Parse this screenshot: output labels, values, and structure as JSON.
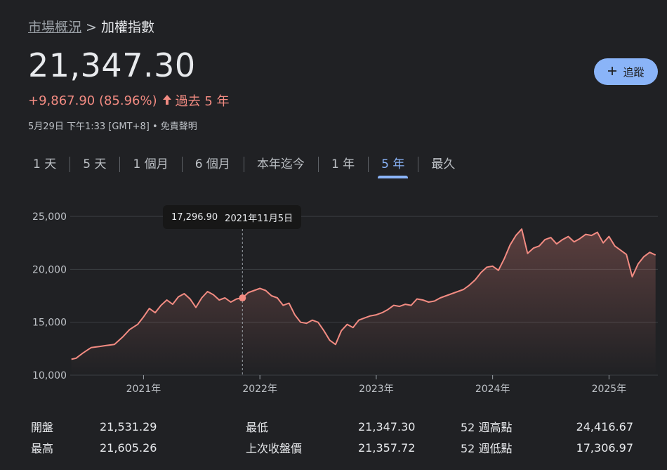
{
  "breadcrumb": {
    "parent": "市場概況",
    "separator": ">",
    "current": "加權指數"
  },
  "price": "21,347.30",
  "change": {
    "text": "+9,867.90 (85.96%)",
    "arrow": "🠅",
    "period": "過去 5 年"
  },
  "meta": "5月29日 下午1:33 [GMT+8] • 免責聲明",
  "follow_button": {
    "icon": "plus-icon",
    "label": "追蹤"
  },
  "tabs": [
    "1 天",
    "5 天",
    "1 個月",
    "6 個月",
    "本年迄今",
    "1 年",
    "5 年",
    "最久"
  ],
  "active_tab": "5 年",
  "colors": {
    "line": "#f28b82",
    "accent": "#8ab4f8",
    "background": "#202124"
  },
  "tooltip": {
    "value": "17,296.90",
    "date": "2021年11月5日"
  },
  "chart_data": {
    "type": "area",
    "ylim": [
      10000,
      25000
    ],
    "y_ticks": [
      "25,000",
      "20,000",
      "15,000",
      "10,000"
    ],
    "x_ticks": [
      "2021年",
      "2022年",
      "2023年",
      "2024年",
      "2025年"
    ],
    "xlim": [
      2020.37,
      2025.42
    ],
    "highlight": {
      "x": 2021.85,
      "y": 17296.9
    },
    "series": [
      {
        "x": [
          2020.38,
          2020.42,
          2020.48,
          2020.55,
          2020.62,
          2020.68,
          2020.75,
          2020.82,
          2020.88,
          2020.95,
          2021.0,
          2021.05,
          2021.1,
          2021.15,
          2021.2,
          2021.25,
          2021.3,
          2021.35,
          2021.4,
          2021.45,
          2021.5,
          2021.55,
          2021.6,
          2021.65,
          2021.7,
          2021.75,
          2021.8,
          2021.85,
          2021.9,
          2021.95,
          2022.0,
          2022.05,
          2022.1,
          2022.15,
          2022.2,
          2022.25,
          2022.3,
          2022.35,
          2022.4,
          2022.45,
          2022.5,
          2022.55,
          2022.6,
          2022.65,
          2022.7,
          2022.75,
          2022.8,
          2022.85,
          2022.9,
          2022.95,
          2023.0,
          2023.05,
          2023.1,
          2023.15,
          2023.2,
          2023.25,
          2023.3,
          2023.35,
          2023.4,
          2023.45,
          2023.5,
          2023.55,
          2023.6,
          2023.65,
          2023.7,
          2023.75,
          2023.8,
          2023.85,
          2023.9,
          2023.95,
          2024.0,
          2024.05,
          2024.1,
          2024.15,
          2024.2,
          2024.25,
          2024.3,
          2024.35,
          2024.4,
          2024.45,
          2024.5,
          2024.55,
          2024.6,
          2024.65,
          2024.7,
          2024.75,
          2024.8,
          2024.85,
          2024.9,
          2024.95,
          2025.0,
          2025.05,
          2025.1,
          2025.15,
          2025.2,
          2025.25,
          2025.3,
          2025.35,
          2025.4
        ],
        "y": [
          11500,
          11600,
          12100,
          12600,
          12700,
          12800,
          12900,
          13600,
          14300,
          14800,
          15500,
          16300,
          15900,
          16600,
          17100,
          16700,
          17400,
          17700,
          17200,
          16400,
          17300,
          17900,
          17600,
          17100,
          17300,
          16900,
          17200,
          17300,
          17800,
          18000,
          18200,
          18000,
          17500,
          17300,
          16600,
          16800,
          15700,
          15000,
          14900,
          15200,
          15000,
          14200,
          13300,
          12900,
          14200,
          14800,
          14500,
          15200,
          15400,
          15600,
          15700,
          15900,
          16200,
          16600,
          16500,
          16700,
          16600,
          17200,
          17100,
          16900,
          17000,
          17300,
          17500,
          17700,
          17900,
          18100,
          18500,
          19000,
          19700,
          20200,
          20300,
          19900,
          21000,
          22300,
          23200,
          23800,
          21500,
          22000,
          22200,
          22800,
          23000,
          22400,
          22800,
          23100,
          22600,
          22900,
          23300,
          23200,
          23500,
          22500,
          23100,
          22200,
          21800,
          21400,
          19300,
          20500,
          21200,
          21600,
          21350
        ]
      }
    ]
  },
  "stats": [
    {
      "label1": "開盤",
      "value1": "21,531.29",
      "label2": "最低",
      "value2": "21,347.30",
      "label3": "52 週高點",
      "value3": "24,416.67"
    },
    {
      "label1": "最高",
      "value1": "21,605.26",
      "label2": "上次收盤價",
      "value2": "21,357.72",
      "label3": "52 週低點",
      "value3": "17,306.97"
    }
  ]
}
